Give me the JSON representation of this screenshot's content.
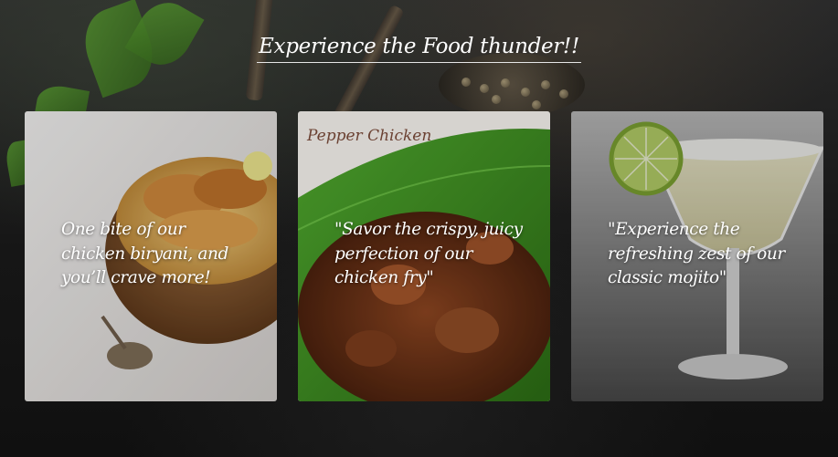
{
  "hero": {
    "title": "Experience the Food thunder!!"
  },
  "cards": [
    {
      "image": "chicken-biryani-bowl",
      "caption": "One bite of our chicken biryani, and you’ll crave more!"
    },
    {
      "image": "pepper-chicken-on-banana-leaf",
      "image_label": "Pepper Chicken",
      "caption": "\"Savor the crispy, juicy perfection of our chicken fry\""
    },
    {
      "image": "classic-mojito-glass-with-lime",
      "caption": "\"Experience the refreshing zest of our classic mojito\""
    }
  ],
  "colors": {
    "background": "#161616",
    "text": "#ffffff",
    "underline": "#e6e6e6"
  }
}
